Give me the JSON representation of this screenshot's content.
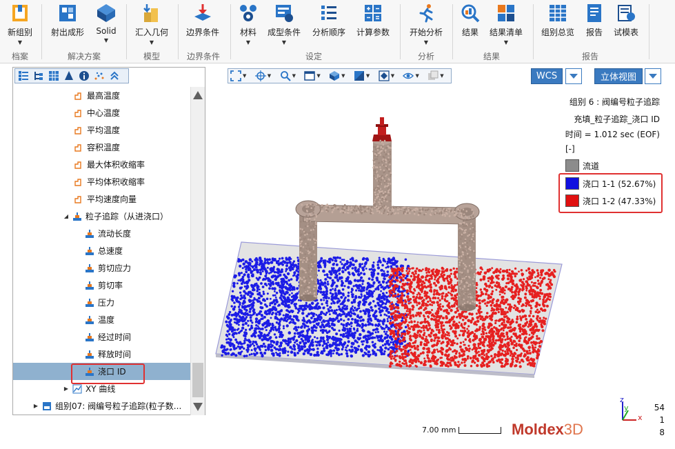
{
  "ribbon": {
    "buttons": [
      {
        "label": "新组别",
        "dropdown": true
      },
      {
        "label": "射出成形",
        "dropdown": false
      },
      {
        "label": "Solid",
        "dropdown": true
      },
      {
        "label": "汇入几何",
        "dropdown": true
      },
      {
        "label": "边界条件",
        "dropdown": false
      },
      {
        "label": "材料",
        "dropdown": true
      },
      {
        "label": "成型条件",
        "dropdown": true
      },
      {
        "label": "分析顺序",
        "dropdown": false
      },
      {
        "label": "计算参数",
        "dropdown": false
      },
      {
        "label": "开始分析",
        "dropdown": true
      },
      {
        "label": "结果",
        "dropdown": false
      },
      {
        "label": "结果清单",
        "dropdown": true
      },
      {
        "label": "组别总览",
        "dropdown": false
      },
      {
        "label": "报告",
        "dropdown": false
      },
      {
        "label": "试模表",
        "dropdown": false
      }
    ],
    "groups": [
      "档案",
      "解决方案",
      "模型",
      "边界条件",
      "设定",
      "分析",
      "结果",
      "报告"
    ]
  },
  "tree": {
    "items": [
      {
        "label": "最高温度",
        "level": 1
      },
      {
        "label": "中心温度",
        "level": 1
      },
      {
        "label": "平均温度",
        "level": 1
      },
      {
        "label": "容积温度",
        "level": 1
      },
      {
        "label": "最大体积收缩率",
        "level": 1
      },
      {
        "label": "平均体积收缩率",
        "level": 1
      },
      {
        "label": "平均速度向量",
        "level": 1
      },
      {
        "label": "粒子追踪（从进浇口）",
        "level": 0,
        "expanded": true
      },
      {
        "label": "流动长度",
        "level": 2
      },
      {
        "label": "总速度",
        "level": 2
      },
      {
        "label": "剪切应力",
        "level": 2
      },
      {
        "label": "剪切率",
        "level": 2
      },
      {
        "label": "压力",
        "level": 2
      },
      {
        "label": "温度",
        "level": 2
      },
      {
        "label": "经过时间",
        "level": 2
      },
      {
        "label": "释放时间",
        "level": 2
      },
      {
        "label": "浇口 ID",
        "level": 2,
        "selected": true
      },
      {
        "label": "XY 曲线",
        "level": 0,
        "expanded": false
      },
      {
        "label": "组别07:  阀编号粒子追踪(粒子数...",
        "level": -1,
        "expanded": false
      }
    ]
  },
  "view": {
    "wcs_label": "WCS",
    "view_label": "立体视图"
  },
  "info": {
    "line1": "组别 6 : 阀编号粒子追踪",
    "line2": "充填_粒子追踪_浇口 ID",
    "line3": "时间 = 1.012 sec (EOF)",
    "unit": "[-]"
  },
  "legend": [
    {
      "label": "流道",
      "color": "#8c8c8c"
    },
    {
      "label": "浇口 1-1 (52.67%)",
      "color": "#1010e0"
    },
    {
      "label": "浇口 1-2 (47.33%)",
      "color": "#e01010"
    }
  ],
  "scale_label": "7.00 mm",
  "brand": {
    "main": "Moldex",
    "suffix": "3D"
  },
  "axis": {
    "z": "z",
    "y": "y",
    "x": "x"
  },
  "corner_numbers": [
    "54",
    "1",
    "8"
  ]
}
